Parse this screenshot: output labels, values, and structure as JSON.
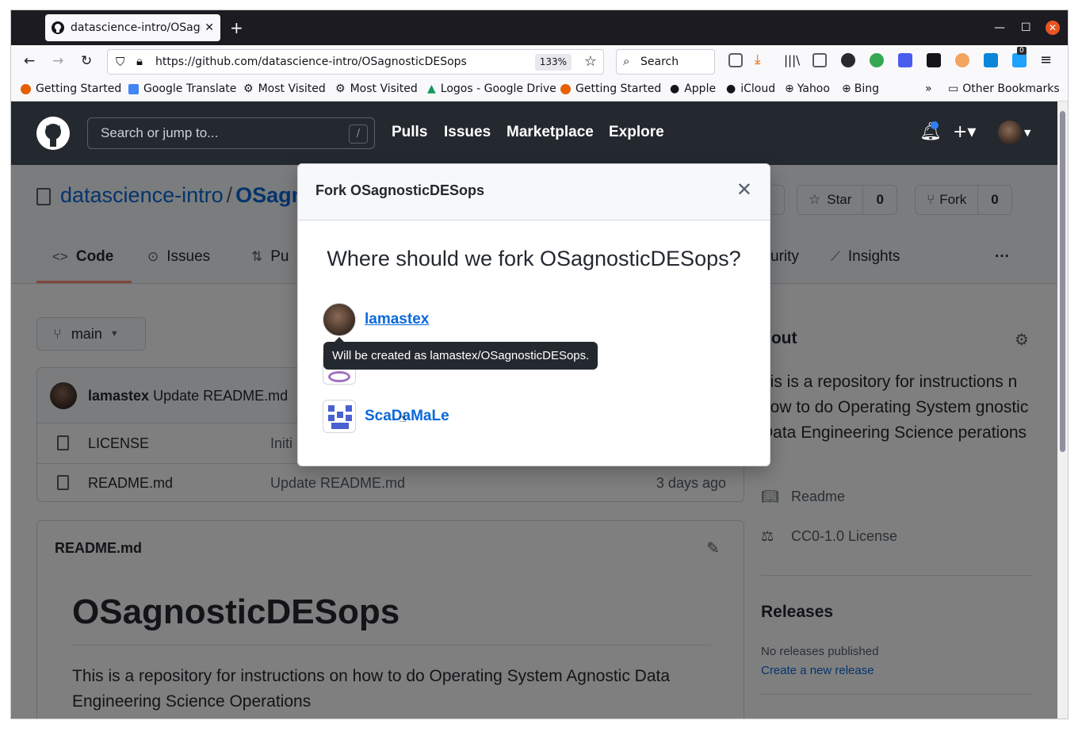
{
  "browser": {
    "tab_title": "datascience-intro/OSagnosticDESops",
    "new_tab": "+",
    "url": "https://github.com/datascience-intro/OSagnosticDESops",
    "zoom": "133%",
    "search_placeholder": "Search",
    "download_badge": "0",
    "bookmarks": [
      {
        "label": "Getting Started",
        "color": "#e66000"
      },
      {
        "label": "Google Translate",
        "color": "#4285f4"
      },
      {
        "label": "Most Visited",
        "color": "#5b5b66"
      },
      {
        "label": "Most Visited",
        "color": "#5b5b66"
      },
      {
        "label": "Logos - Google Drive",
        "color": "#0f9d58"
      },
      {
        "label": "Getting Started",
        "color": "#e66000"
      },
      {
        "label": "Apple",
        "color": "#5b5b66"
      },
      {
        "label": "iCloud",
        "color": "#5b5b66"
      },
      {
        "label": "Yahoo",
        "color": "#5b5b66"
      },
      {
        "label": "Bing",
        "color": "#5b5b66"
      }
    ],
    "other_bookmarks": "Other Bookmarks"
  },
  "github": {
    "search_placeholder": "Search or jump to...",
    "search_shortcut": "/",
    "nav": [
      "Pulls",
      "Issues",
      "Marketplace",
      "Explore"
    ],
    "repo_owner": "datascience-intro",
    "repo_sep": "/",
    "repo_name_visible": "OSagn",
    "star_label": "Star",
    "star_count": "0",
    "fork_label": "Fork",
    "fork_count": "0",
    "tabs": {
      "code": "Code",
      "issues": "Issues",
      "pulls_partial": "Pu",
      "security_partial": "urity",
      "insights": "Insights",
      "more": "···"
    },
    "branch": "main",
    "latest_commit": {
      "author": "lamastex",
      "message": "Update README.md"
    },
    "files": [
      {
        "name": "LICENSE",
        "commit": "Initi",
        "age": ""
      },
      {
        "name": "README.md",
        "commit": "Update README.md",
        "age": "3 days ago"
      }
    ],
    "readme": {
      "file_label": "README.md",
      "heading": "OSagnosticDESops",
      "body": "This is a repository for instructions on how to do Operating System Agnostic Data Engineering Science Operations"
    },
    "about": {
      "title": "bout",
      "description": "his is a repository for instructions n how to do Operating System gnostic Data Engineering Science perations",
      "readme_link": "Readme",
      "license_link": "CC0-1.0 License"
    },
    "releases": {
      "title": "Releases",
      "none": "No releases published",
      "create": "Create a new release"
    }
  },
  "modal": {
    "title": "Fork OSagnosticDESops",
    "question": "Where should we fork OSagnosticDESops?",
    "owners": [
      "lamastex",
      "ScaDaMaLe"
    ],
    "tooltip": "Will be created as lamastex/OSagnosticDESops."
  }
}
